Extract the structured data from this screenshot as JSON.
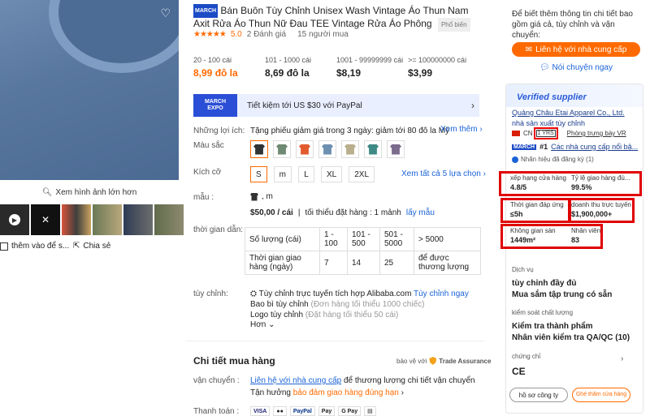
{
  "gallery": {
    "zoom_label": "Xem hình ảnh lớn hơn",
    "save_label": "thêm vào để s...",
    "share_label": "Chia sẻ"
  },
  "product": {
    "badge": "MARCH",
    "title": "Bán Buôn Tùy Chỉnh Unisex Wash Vintage Áo Thun Nam Axit Rửa Áo Thun Nữ Đau TEE Vintage Rửa Áo Phông",
    "popular": "Phổ biến",
    "rating": "5.0",
    "reviews": "2 Đánh giá",
    "buyers": "15 người mua"
  },
  "tiers": [
    {
      "qty": "20 - 100 cái",
      "price": "8,99 đô la"
    },
    {
      "qty": "101 - 1000 cái",
      "price": "8,69 đô la"
    },
    {
      "qty": "1001 - 99999999 cái",
      "price": "$8,19"
    },
    {
      "qty": ">= 100000000 cái",
      "price": "$3,99"
    }
  ],
  "expo": {
    "logo_line1": "MARCH",
    "logo_line2": "EXPO",
    "text": "Tiết kiệm tới US $30 với PayPal"
  },
  "benefits": {
    "label": "Những lợi ích:",
    "text": "Tặng phiếu giảm giá trong 3 ngày: giảm tới 80 đô la Mỹ",
    "more": "Xem thêm"
  },
  "color": {
    "label": "Màu sắc",
    "swatches": [
      "#2f3333",
      "#6f8a72",
      "#e25a2e",
      "#6d8fb0",
      "#b9ae8d",
      "#3f8a86",
      "#7b6b8d"
    ]
  },
  "size": {
    "label": "Kích cỡ",
    "options": [
      "S",
      "m",
      "L",
      "XL",
      "2XL"
    ],
    "all": "Xem tất cả 5 lựa chọn"
  },
  "style": {
    "label": "mẫu :",
    "value": ", m",
    "price": "$50,00 / cái",
    "min": "tối thiểu đặt hàng : 1 mảnh",
    "sample": "lấy mẫu"
  },
  "lead": {
    "label": "thời gian dẫn:",
    "row1": [
      "Số lượng (cái)",
      "1 - 100",
      "101 - 500",
      "501 - 5000",
      "> 5000"
    ],
    "row2": [
      "Thời gian giao hàng (ngày)",
      "7",
      "14",
      "25",
      "để được thương lượng"
    ]
  },
  "custom": {
    "label": "tùy chỉnh:",
    "line1": "Tùy chỉnh trực tuyến tích hợp Alibaba.com",
    "line1_link": "Tùy chỉnh ngay",
    "line2": "Bao bì tùy chỉnh",
    "line2_note": "(Đơn hàng tối thiểu 1000 chiếc)",
    "line3": "Logo tùy chỉnh",
    "line3_note": "(Đặt hàng tối thiểu 50 cái)",
    "more": "Hơn"
  },
  "purchase": {
    "title": "Chi tiết mua hàng",
    "protect": "bảo vệ với",
    "assurance": "Trade Assurance",
    "ship_label": "vận chuyển :",
    "ship_link": "Liên hệ với nhà cung cấp",
    "ship_text": "để thương lượng chi tiết vận chuyển",
    "enjoy": "Tận hưởng",
    "enjoy_link": "bảo đảm giao hàng đúng hạn",
    "pay_label": "Thanh toán :",
    "pay_methods": [
      "VISA",
      "●●",
      "PayPal",
      "Pay",
      "G Pay",
      "▤"
    ]
  },
  "right": {
    "info": "Để biết thêm thông tin chi tiết bao gồm giá cả, tùy chỉnh và vận chuyển:",
    "contact": "Liên hệ với nhà cung cấp",
    "chat": "Nói chuyện ngay",
    "verified": "Verified supplier",
    "supplier_name": "Quảng Châu Etai Apparel Co., Ltd.",
    "supplier_type": "nhà sản xuất tùy chỉnh",
    "country": "CN",
    "years": "1 YRS",
    "showroom": "Phòng trưng bày VR",
    "rank_badge": "MARCH",
    "rank": "#1",
    "rank_text": "Các nhà cung cấp nổi bậ...",
    "registered": "Nhãn hiệu đã đăng ký (1)",
    "stats": [
      {
        "label": "xếp hạng cửa hàng",
        "value": "4.8/5"
      },
      {
        "label": "Tỷ lệ giao hàng đú...",
        "value": "99.5%"
      },
      {
        "label": "Thời gian đáp ứng",
        "value": "≤5h"
      },
      {
        "label": "doanh thu trực tuyến",
        "value": "$1,900,000+"
      },
      {
        "label": "Không gian sàn",
        "value": "1449m²"
      },
      {
        "label": "Nhân viên",
        "value": "83"
      }
    ],
    "service_label": "Dịch vụ",
    "service_1": "tùy chỉnh đầy đủ",
    "service_2": "Mua sắm tập trung có sẵn",
    "qc_label": "kiểm soát chất lượng",
    "qc_1": "Kiểm tra thành phẩm",
    "qc_2": "Nhân viên kiểm tra QA/QC (10)",
    "cert_label": "chứng chỉ",
    "cert": "CE",
    "profile_btn": "hồ sơ công ty",
    "visit_btn": "Ghé thăm cửa hàng"
  }
}
